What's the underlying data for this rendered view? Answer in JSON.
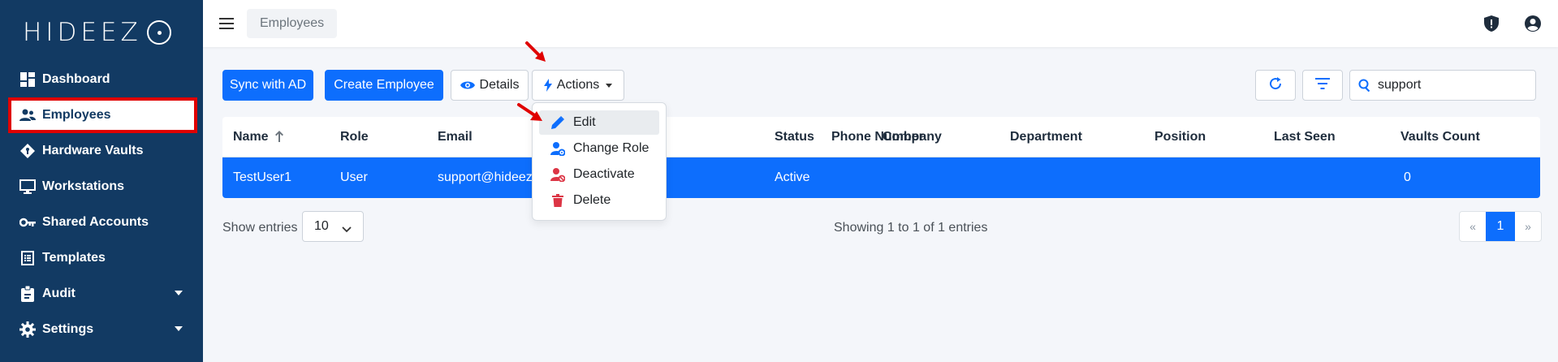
{
  "brand": {
    "logo_text": "HIDEEZ"
  },
  "sidebar": {
    "items": [
      {
        "label": "Dashboard",
        "icon": "dashboard-icon"
      },
      {
        "label": "Employees",
        "icon": "users-icon",
        "active": true
      },
      {
        "label": "Hardware Vaults",
        "icon": "diamond-key-icon"
      },
      {
        "label": "Workstations",
        "icon": "monitor-icon"
      },
      {
        "label": "Shared Accounts",
        "icon": "key-icon"
      },
      {
        "label": "Templates",
        "icon": "list-icon"
      },
      {
        "label": "Audit",
        "icon": "clipboard-icon",
        "expandable": true
      },
      {
        "label": "Settings",
        "icon": "gear-icon",
        "expandable": true
      }
    ]
  },
  "header": {
    "breadcrumb": "Employees",
    "icons": [
      "shield-icon",
      "account-icon"
    ]
  },
  "toolbar": {
    "sync_label": "Sync with AD",
    "create_label": "Create Employee",
    "details_label": "Details",
    "actions_label": "Actions",
    "search_value": "support"
  },
  "actions_menu": {
    "items": [
      "Edit",
      "Change Role",
      "Deactivate",
      "Delete"
    ]
  },
  "table": {
    "columns": [
      "Name",
      "Role",
      "Email",
      "Phone Number",
      "Status",
      "Company",
      "Department",
      "Position",
      "Last Seen",
      "Vaults Count"
    ],
    "rows": [
      {
        "name": "TestUser1",
        "role": "User",
        "email": "support@hideez.com",
        "phone": "",
        "status": "Active",
        "company": "",
        "department": "",
        "position": "",
        "last_seen": "",
        "vaults_count": "0"
      }
    ]
  },
  "footer": {
    "show_entries_label": "Show entries",
    "page_size": "10",
    "showing_text": "Showing 1 to 1 of 1 entries",
    "pager_prev": "«",
    "pager_current": "1",
    "pager_next": "»"
  },
  "colors": {
    "sidebar_bg": "#123a63",
    "primary": "#0d6efd",
    "annotation_red": "#e00000",
    "danger": "#dc3545"
  }
}
